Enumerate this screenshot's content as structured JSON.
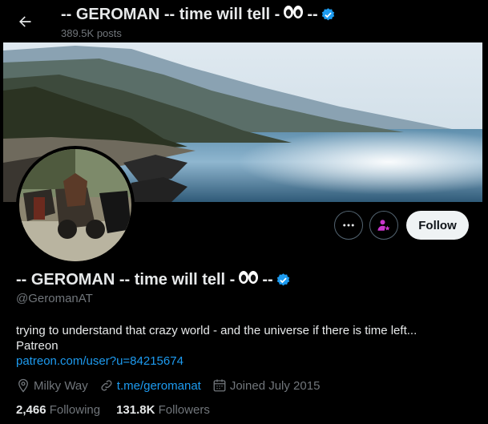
{
  "header": {
    "title_prefix": "-- GEROMAN -- time will tell -",
    "title_suffix": "--",
    "posts_count": "389.5K posts"
  },
  "profile": {
    "name_prefix": "-- GEROMAN -- time will tell -",
    "name_suffix": "--",
    "handle": "@GeromanAT",
    "bio_line1": "trying to understand that crazy world - and the universe if there is time left...",
    "bio_line2": "Patreon",
    "bio_link": "patreon.com/user?u=84215674",
    "location": "Milky Way",
    "website": "t.me/geromanat",
    "joined": "Joined July 2015"
  },
  "actions": {
    "follow_label": "Follow"
  },
  "stats": {
    "following_count": "2,466",
    "following_label": "Following",
    "followers_count": "131.8K",
    "followers_label": "Followers"
  },
  "icons": [
    "back-arrow-icon",
    "verified-badge-icon",
    "eyes-emoji-icon",
    "more-dots-icon",
    "subscribe-person-star-icon",
    "location-pin-icon",
    "link-icon",
    "calendar-icon"
  ],
  "colors": {
    "background": "#000000",
    "accent": "#1d9bf0",
    "text": "#e7e9ea",
    "secondary_text": "#71767b",
    "subscribe": "#c936cc"
  }
}
